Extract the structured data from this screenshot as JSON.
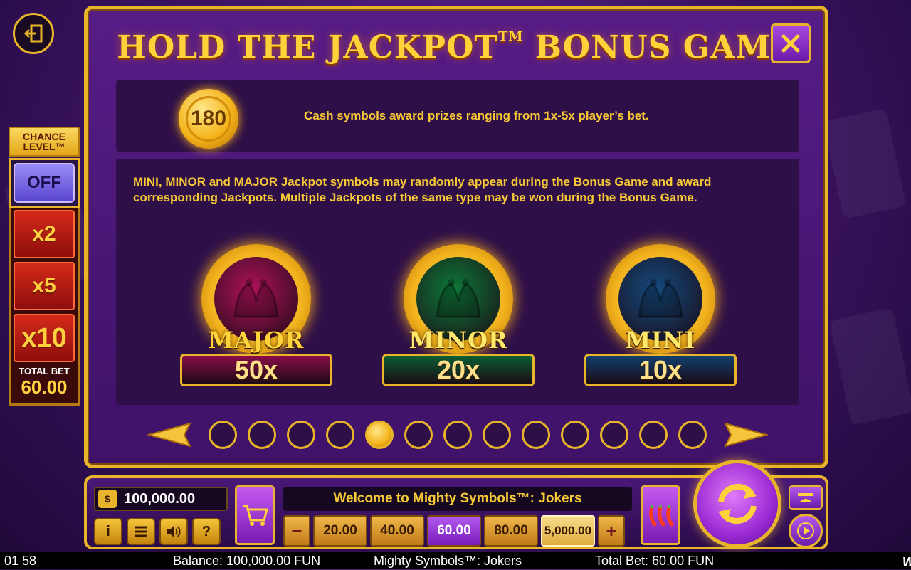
{
  "title": "HOLD THE JACKPOT",
  "title_tm": "TM",
  "title_suffix": "BONUS GAME",
  "cash_coin_value": "180",
  "cash_text": "Cash symbols award prizes ranging from 1x-5x player’s bet.",
  "jackpot_text": "MINI, MINOR and MAJOR Jackpot symbols may randomly appear during the Bonus Game and award corresponding Jackpots. Multiple Jackpots of the same type may be won during the Bonus Game.",
  "jackpots": [
    {
      "name": "MAJOR",
      "value": "50x",
      "face": "#b0125a",
      "bar": "#8a0c48",
      "name_color": "#ffd23a"
    },
    {
      "name": "MINOR",
      "value": "20x",
      "face": "#0e7a3a",
      "bar": "#0c5e32",
      "name_color": "#ffe86a"
    },
    {
      "name": "MINI",
      "value": "10x",
      "face": "#144a7e",
      "bar": "#12406e",
      "name_color": "#ffe86a"
    }
  ],
  "pager": {
    "total": 13,
    "active_index": 4
  },
  "chance": {
    "title": "CHANCE LEVEL™",
    "off_label": "OFF",
    "multipliers": [
      "x2",
      "x5",
      "x10"
    ],
    "total_bet_label": "TOTAL BET",
    "total_bet_value": "60.00"
  },
  "bottom": {
    "balance": "100,000.00",
    "welcome": "Welcome to Mighty Symbols™: Jokers",
    "bet_minus": "−",
    "bet_plus": "+",
    "bets": [
      "20.00",
      "40.00",
      "60.00",
      "80.00",
      "5,000.00"
    ],
    "selected_bet": "60.00",
    "info_icon": "i",
    "help_icon": "?"
  },
  "status": {
    "time": "01 58",
    "balance": "Balance: 100,000.00 FUN",
    "game": "Mighty Symbols™: Jokers",
    "total_bet": "Total Bet: 60.00 FUN",
    "brand": "Wazdan"
  },
  "colors": {
    "gold": "#e8b52a",
    "panel": "#571c86",
    "text_gold": "#f7c935"
  }
}
